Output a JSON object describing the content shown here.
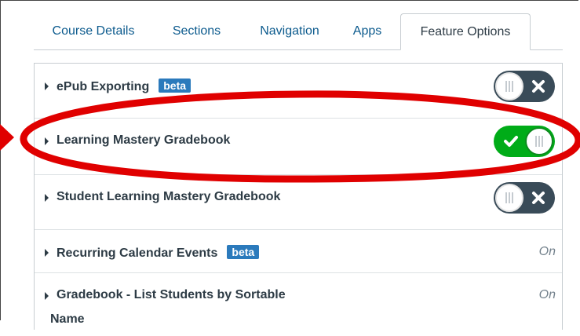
{
  "tabs": [
    {
      "label": "Course Details",
      "active": false
    },
    {
      "label": "Sections",
      "active": false
    },
    {
      "label": "Navigation",
      "active": false
    },
    {
      "label": "Apps",
      "active": false
    },
    {
      "label": "Feature Options",
      "active": true
    }
  ],
  "features": [
    {
      "label": "ePub Exporting",
      "badge": "beta",
      "control": "toggle",
      "state": "off"
    },
    {
      "label": "Learning Mastery Gradebook",
      "badge": "",
      "control": "toggle",
      "state": "on"
    },
    {
      "label": "Student Learning Mastery Gradebook",
      "badge": "",
      "control": "toggle",
      "state": "off"
    },
    {
      "label": "Recurring Calendar Events",
      "badge": "beta",
      "control": "text",
      "state_text": "On"
    },
    {
      "label": "Gradebook - List Students by Sortable",
      "label_line2": "Name",
      "badge": "",
      "control": "text",
      "state_text": "On"
    }
  ],
  "colors": {
    "link": "#0b5a8d",
    "badge": "#2b7abc",
    "toggle_off": "#394b58",
    "toggle_on": "#00ac18",
    "highlight": "#e00000"
  },
  "icons": {
    "expand": "caret-right-icon",
    "off": "x-icon",
    "on": "check-icon"
  }
}
